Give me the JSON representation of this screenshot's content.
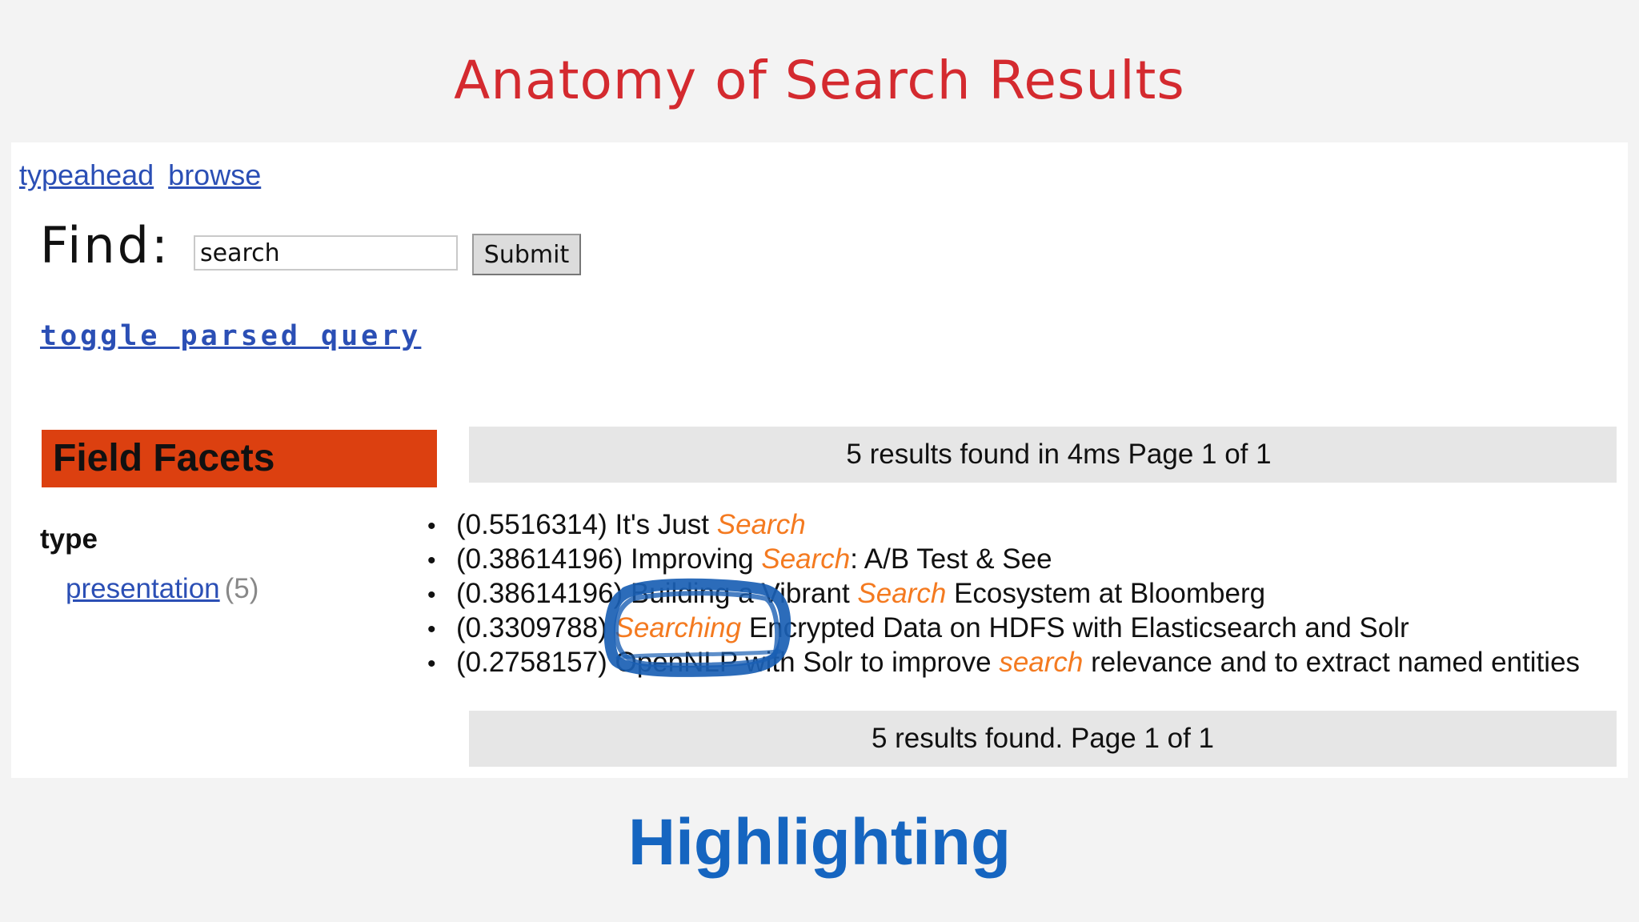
{
  "slide": {
    "title": "Anatomy of Search Results",
    "subtitle": "Highlighting"
  },
  "nav": {
    "links": [
      "typeahead",
      "browse"
    ]
  },
  "search": {
    "label": "Find:",
    "value": "search",
    "submit_label": "Submit",
    "toggle_label": "toggle parsed query"
  },
  "facets": {
    "header": "Field Facets",
    "field": "type",
    "items": [
      {
        "label": "presentation",
        "count": "(5)"
      }
    ]
  },
  "results": {
    "summary_top": "5 results found in 4ms Page 1 of 1",
    "summary_bottom": "5 results found. Page 1 of 1",
    "items": [
      {
        "score": "(0.5516314)",
        "pre": " It's Just ",
        "hl": "Search",
        "post": ""
      },
      {
        "score": "(0.38614196)",
        "pre": " Improving ",
        "hl": "Search",
        "post": ": A/B Test & See"
      },
      {
        "score": "(0.38614196)",
        "pre": " Building a Vibrant ",
        "hl": "Search",
        "post": " Ecosystem at Bloomberg"
      },
      {
        "score": "(0.3309788)",
        "pre": " ",
        "hl": "Searching",
        "post": " Encrypted Data on HDFS with Elasticsearch and Solr"
      },
      {
        "score": "(0.2758157)",
        "pre": " OpenNLP with Solr to improve ",
        "hl": "search",
        "post": " relevance and to extract named entities"
      }
    ]
  },
  "colors": {
    "title": "#d42a2f",
    "facet_header": "#dc4010",
    "highlight": "#f47a20",
    "link": "#2b4fb5",
    "subtitle": "#1565c0",
    "annotation": "#1a5fb4"
  }
}
